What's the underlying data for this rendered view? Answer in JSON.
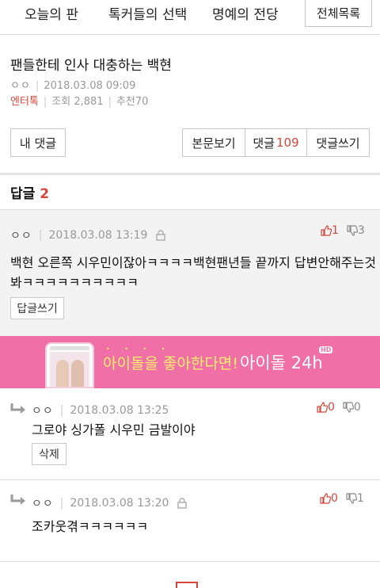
{
  "nav": {
    "tabs": [
      "오늘의 판",
      "톡커들의 선택",
      "명예의 전당"
    ],
    "list_button": "전체목록"
  },
  "post": {
    "title": "팬들한테 인사 대충하는 백현",
    "author": "ㅇㅇ",
    "datetime": "2018.03.08 09:09",
    "category": "엔터톡",
    "views_label": "조회",
    "views": "2,881",
    "recommend_label": "추천",
    "recommend": "70"
  },
  "actions": {
    "my_comments": "내 댓글",
    "view_post": "본문보기",
    "comments_label": "댓글",
    "comments_count": "109",
    "write_comment": "댓글쓰기"
  },
  "replies": {
    "label": "답글",
    "count": "2"
  },
  "main_comment": {
    "author": "ㅇㅇ",
    "datetime": "2018.03.08 13:19",
    "up": "1",
    "down": "3",
    "text_line1": "백현 오른쪽 시우민이잖아ㅋㅋㅋㅋ백현팬년들 끝까지 답변안해주는것",
    "text_line2": "봐ㅋㅋㅋㅋㅋㅋㅋㅋㅋㅋ",
    "reply_button": "답글쓰기"
  },
  "banner": {
    "text_yellow": "아이돌을 좋아한다면!",
    "text_white": "아이돌 24h",
    "badge": "HD"
  },
  "reply_1": {
    "author": "ㅇㅇ",
    "datetime": "2018.03.08 13:25",
    "up": "0",
    "down": "0",
    "text": "그로야 싱가폴 시우민 금발이야",
    "delete_button": "삭제"
  },
  "reply_2": {
    "author": "ㅇㅇ",
    "datetime": "2018.03.08 13:20",
    "up": "0",
    "down": "1",
    "text": "조카웃겪ㅋㅋㅋㅋㅋㅋ"
  },
  "colors": {
    "accent": "#d6453a",
    "banner_bg": "#ef6fa6",
    "banner_yellow": "#fdf06a"
  },
  "icons": [
    "thumbs-up-icon",
    "thumbs-down-icon",
    "lock-icon",
    "reply-arrow-icon",
    "phone-illustration"
  ]
}
